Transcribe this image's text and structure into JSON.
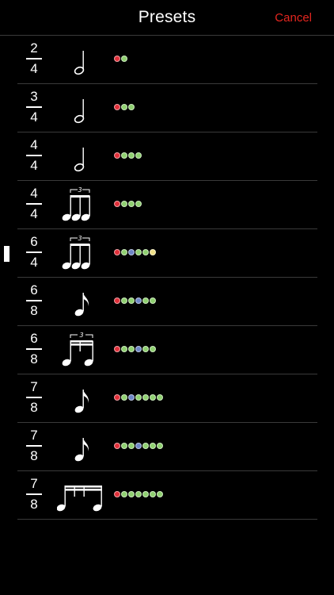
{
  "header": {
    "title": "Presets",
    "cancel_label": "Cancel"
  },
  "colors": {
    "background": "#000000",
    "cancel": "#e5261f",
    "separator": "#3a3a3a",
    "dot_red": "#e0303a",
    "dot_green": "#8fd070",
    "dot_blue": "#6e86c6",
    "dot_yellow": "#f0e088"
  },
  "presets": [
    {
      "numerator": "2",
      "denominator": "4",
      "note_icon": "half-note-icon",
      "dots": [
        "red",
        "green"
      ]
    },
    {
      "numerator": "3",
      "denominator": "4",
      "note_icon": "half-note-icon",
      "dots": [
        "red",
        "green",
        "green"
      ]
    },
    {
      "numerator": "4",
      "denominator": "4",
      "note_icon": "half-note-icon",
      "dots": [
        "red",
        "green",
        "green",
        "green"
      ]
    },
    {
      "numerator": "4",
      "denominator": "4",
      "note_icon": "quarter-triplet-icon",
      "triplet_label": "3",
      "dots": [
        "red",
        "green",
        "green",
        "green"
      ]
    },
    {
      "numerator": "6",
      "denominator": "4",
      "note_icon": "quarter-triplet-icon",
      "triplet_label": "3",
      "dots": [
        "red",
        "green",
        "blue",
        "green",
        "green",
        "yellow"
      ]
    },
    {
      "numerator": "6",
      "denominator": "8",
      "note_icon": "eighth-note-icon",
      "dots": [
        "red",
        "green",
        "green",
        "blue",
        "green",
        "green"
      ]
    },
    {
      "numerator": "6",
      "denominator": "8",
      "note_icon": "eighth-triplet-icon",
      "triplet_label": "3",
      "dots": [
        "red",
        "green",
        "green",
        "blue",
        "green",
        "green"
      ]
    },
    {
      "numerator": "7",
      "denominator": "8",
      "note_icon": "eighth-note-icon",
      "dots": [
        "red",
        "green",
        "blue",
        "green",
        "green",
        "green",
        "green"
      ]
    },
    {
      "numerator": "7",
      "denominator": "8",
      "note_icon": "eighth-note-icon",
      "dots": [
        "red",
        "green",
        "green",
        "blue",
        "green",
        "green",
        "green"
      ]
    },
    {
      "numerator": "7",
      "denominator": "8",
      "note_icon": "sixteenth-beamed-icon",
      "dots": [
        "red",
        "green",
        "green",
        "green",
        "green",
        "green",
        "green"
      ]
    }
  ]
}
